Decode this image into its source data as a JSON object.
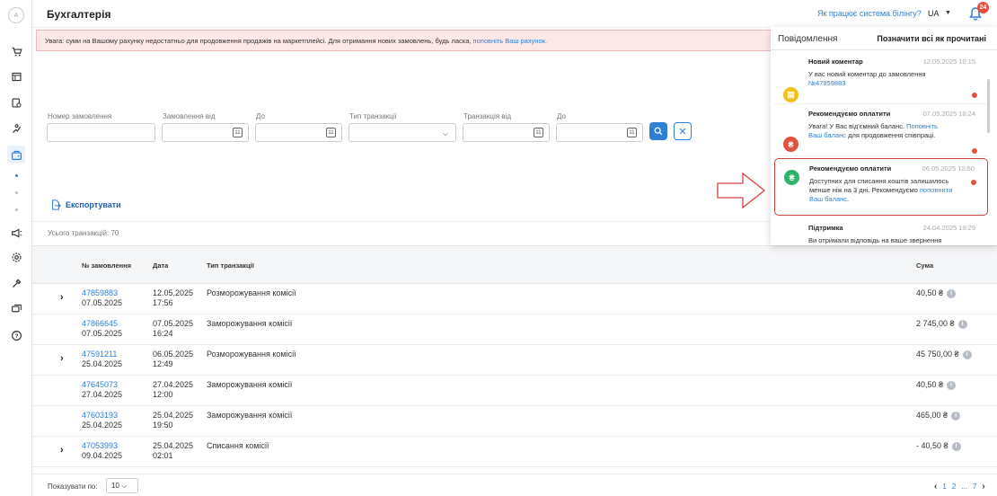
{
  "header": {
    "title": "Бухгалтерія",
    "billing_link": "Як працює система білінгу?",
    "language": "UA",
    "notification_count": "24"
  },
  "sidebar": {
    "avatar": "A"
  },
  "warning": {
    "text": "Увага: суми на Вашому рахунку недостатньо для продовження продажів на маркетплейсі. Для отримання нових замовлень, будь ласка, ",
    "link": "поповніть Ваш рахунок."
  },
  "filters": {
    "order_number_label": "Номер замовлення",
    "order_from_label": "Замовлення від",
    "order_to_label": "До",
    "transaction_type_label": "Тип транзакції",
    "transaction_from_label": "Транзакція від",
    "transaction_to_label": "До"
  },
  "export_label": "Експортувати",
  "total_label": "Усього транзакцій: 70",
  "table": {
    "headers": {
      "order": "№ замовлення",
      "date": "Дата",
      "type": "Тип транзакції",
      "sum": "Сума"
    },
    "rows": [
      {
        "order_id": "47859883",
        "order_date": "07.05.2025",
        "date": "12.05.2025",
        "time": "17:56",
        "type": "Розморожування комісії",
        "sum": "40,50 ₴",
        "expandable": true
      },
      {
        "order_id": "47866645",
        "order_date": "07.05.2025",
        "date": "07.05.2025",
        "time": "16:24",
        "type": "Заморожування комісії",
        "sum": "2 745,00 ₴",
        "expandable": false
      },
      {
        "order_id": "47591211",
        "order_date": "25.04.2025",
        "date": "06.05.2025",
        "time": "12:49",
        "type": "Розморожування комісії",
        "sum": "45 750,00 ₴",
        "expandable": true
      },
      {
        "order_id": "47645073",
        "order_date": "27.04.2025",
        "date": "27.04.2025",
        "time": "12:00",
        "type": "Заморожування комісії",
        "sum": "40,50 ₴",
        "expandable": false
      },
      {
        "order_id": "47603193",
        "order_date": "25.04.2025",
        "date": "25.04.2025",
        "time": "19:50",
        "type": "Заморожування комісії",
        "sum": "465,00 ₴",
        "expandable": false
      },
      {
        "order_id": "47053993",
        "order_date": "09.04.2025",
        "date": "25.04.2025",
        "time": "02:01",
        "type": "Списання комісії",
        "sum": "- 40,50 ₴",
        "expandable": true
      }
    ]
  },
  "footer": {
    "per_page_label": "Показувати по:",
    "per_page_value": "10",
    "page_current": "1",
    "page_next": "2",
    "page_ellipsis": "...",
    "page_last": "7"
  },
  "notifications": {
    "title": "Повідомлення",
    "mark_all": "Позначити всі як прочитані",
    "items": [
      {
        "title": "Новий коментар",
        "date": "12.05.2025 16:15",
        "body": "У вас новий коментар до замовлення ",
        "link": "№47859883",
        "body_after": "",
        "icon": "comment-icon",
        "color": "#f2c21b"
      },
      {
        "title": "Рекомендуємо оплатити",
        "date": "07.05.2025 16:24",
        "body": "Увага! У Вас від'ємний баланс. ",
        "link": "Поповніть Ваш баланс",
        "body_after": " для продовження співпраці.",
        "icon": "hryvnia-icon",
        "color": "#e3513f"
      },
      {
        "title": "Рекомендуємо оплатити",
        "date": "06.05.2025 12:50",
        "body": "Доступних для списання коштів залишилось менше ніж на 3 дні. Рекомендуємо ",
        "link": "поповнити Ваш баланс",
        "body_after": ".",
        "icon": "hryvnia-icon",
        "color": "#2fb26a"
      },
      {
        "title": "Підтримка",
        "date": "24.04.2025 19:29",
        "body": "Ви отримали відповідь на ваше звернення",
        "link": "",
        "body_after": "",
        "icon": "support-icon",
        "color": "#2fb26a"
      }
    ]
  }
}
